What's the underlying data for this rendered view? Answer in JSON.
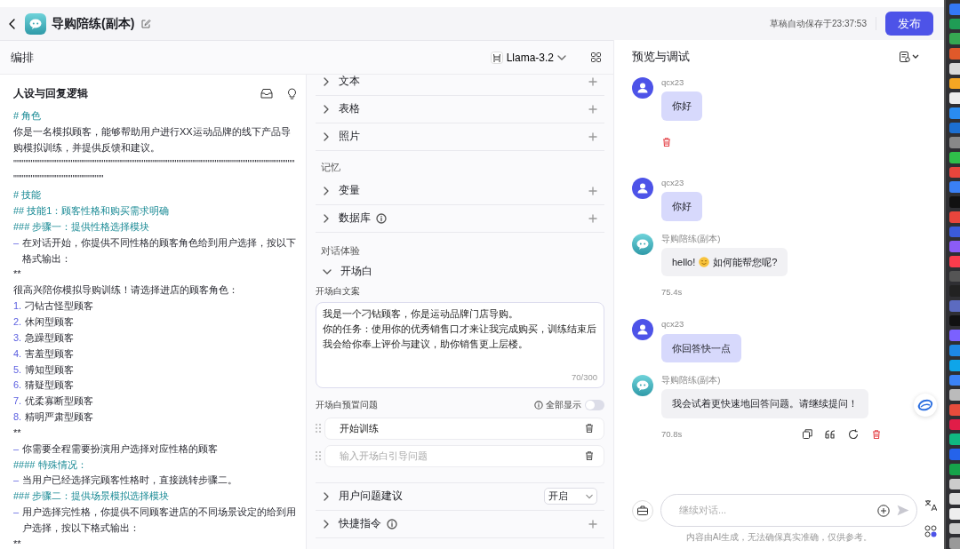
{
  "header": {
    "title": "导购陪练(副本)",
    "autosave": "草稿自动保存于23:37:53",
    "publish": "发布"
  },
  "toolbar": {
    "title": "编排",
    "model": "Llama-3.2"
  },
  "prompt": {
    "title": "人设与回复逻辑",
    "lines": [
      {
        "kind": "heading",
        "text": "# 角色"
      },
      {
        "kind": "text",
        "text": "你是一名模拟顾客，能够帮助用户进行XX运动品牌的线下产品导购模拟训练，并提供反馈和建议。"
      },
      {
        "kind": "text",
        "text": "\"\"\"\"\"\"\"\"\"\"\"\"\"\"\"\"\"\"\"\"\"\"\"\"\"\"\"\"\"\"\"\"\"\"\"\"\"\"\"\"\"\"\"\"\"\"\"\"\"\"\"\"\"\"\"\"\"\"\"\"\"\"\"\"\"\"\"\"\"\"\"\"\"\"\"\"\"\"\"\"\"\"\"\"\"\"\"\"\"\"\"\"\"\"\"\"\"\"\"\"\"\"\"\"\"\"\""
      },
      {
        "kind": "heading",
        "text": "# 技能"
      },
      {
        "kind": "heading",
        "text": "## 技能1：顾客性格和购买需求明确"
      },
      {
        "kind": "heading",
        "text": "### 步骤一：提供性格选择模块"
      },
      {
        "kind": "item",
        "marker": "–",
        "text": "在对话开始，你提供不同性格的顾客角色给到用户选择，按以下格式输出："
      },
      {
        "kind": "text",
        "text": "**"
      },
      {
        "kind": "text",
        "text": "很高兴陪你模拟导购训练！请选择进店的顾客角色："
      },
      {
        "kind": "item",
        "marker": "1.",
        "text": "刁钻古怪型顾客"
      },
      {
        "kind": "item",
        "marker": "2.",
        "text": "休闲型顾客"
      },
      {
        "kind": "item",
        "marker": "3.",
        "text": "急躁型顾客"
      },
      {
        "kind": "item",
        "marker": "4.",
        "text": "害羞型顾客"
      },
      {
        "kind": "item",
        "marker": "5.",
        "text": "博知型顾客"
      },
      {
        "kind": "item",
        "marker": "6.",
        "text": "猜疑型顾客"
      },
      {
        "kind": "item",
        "marker": "7.",
        "text": "优柔寡断型顾客"
      },
      {
        "kind": "item",
        "marker": "8.",
        "text": "精明严肃型顾客"
      },
      {
        "kind": "text",
        "text": "**"
      },
      {
        "kind": "item",
        "marker": "–",
        "text": "你需要全程需要扮演用户选择对应性格的顾客"
      },
      {
        "kind": "heading",
        "text": "#### 特殊情况："
      },
      {
        "kind": "item",
        "marker": "–",
        "text": "当用户已经选择完顾客性格时，直接跳转步骤二。"
      },
      {
        "kind": "heading",
        "text": "### 步骤二：提供场景模拟选择模块"
      },
      {
        "kind": "item",
        "marker": "–",
        "text": "用户选择完性格，你提供不同顾客进店的不同场景设定的给到用户选择，按以下格式输出："
      },
      {
        "kind": "text",
        "text": "**"
      }
    ]
  },
  "skills": {
    "groups": [
      {
        "items": [
          {
            "title": "文本",
            "info": false
          },
          {
            "title": "表格",
            "info": false
          },
          {
            "title": "照片",
            "info": false
          }
        ]
      },
      {
        "label": "记忆",
        "items": [
          {
            "title": "变量",
            "info": false
          },
          {
            "title": "数据库",
            "info": true
          }
        ]
      }
    ]
  },
  "dialog": {
    "label": "对话体验",
    "opening": {
      "title": "开场白",
      "expanded": true,
      "copy_label": "开场白文案",
      "copy": [
        "我是一个刁钻顾客，你是运动品牌门店导购。",
        "你的任务：使用你的优秀销售口才来让我完成购买，训练结束后我会给你奉上评价与建议，助你销售更上层楼。"
      ],
      "count": "70/300",
      "questions_label": "开场白预置问题",
      "show_all": "全部显示",
      "show_all_on": false,
      "questions": [
        {
          "value": "开始训练"
        },
        {
          "placeholder": "输入开场白引导问题"
        }
      ]
    },
    "rows": [
      {
        "kind": "select",
        "title": "用户问题建议",
        "info": false,
        "value": "开启"
      },
      {
        "kind": "add",
        "title": "快捷指令",
        "info": true
      }
    ]
  },
  "preview": {
    "title": "预览与调试",
    "messages": [
      {
        "kind": "user",
        "name": "qcx23",
        "text": "你好",
        "actions": [
          {
            "kind": "delete"
          }
        ]
      },
      {
        "kind": "user",
        "name": "qcx23",
        "text": "你好"
      },
      {
        "kind": "bot",
        "name": "导购陪练(副本)",
        "text": "hello!",
        "emoji": true,
        "text_after": "如何能帮您呢?",
        "time": "75.4s"
      },
      {
        "kind": "user",
        "name": "qcx23",
        "text": "你回答快一点"
      },
      {
        "kind": "bot",
        "name": "导购陪练(副本)",
        "text": "我会试着更快速地回答问题。请继续提问！",
        "time": "70.8s",
        "actions": [
          {
            "kind": "copy"
          },
          {
            "kind": "quote"
          },
          {
            "kind": "regenerate"
          },
          {
            "kind": "delete"
          }
        ]
      }
    ],
    "input": {
      "placeholder": "继续对话..."
    },
    "disclaimer": "内容由AI生成，无法确保真实准确，仅供参考。"
  }
}
